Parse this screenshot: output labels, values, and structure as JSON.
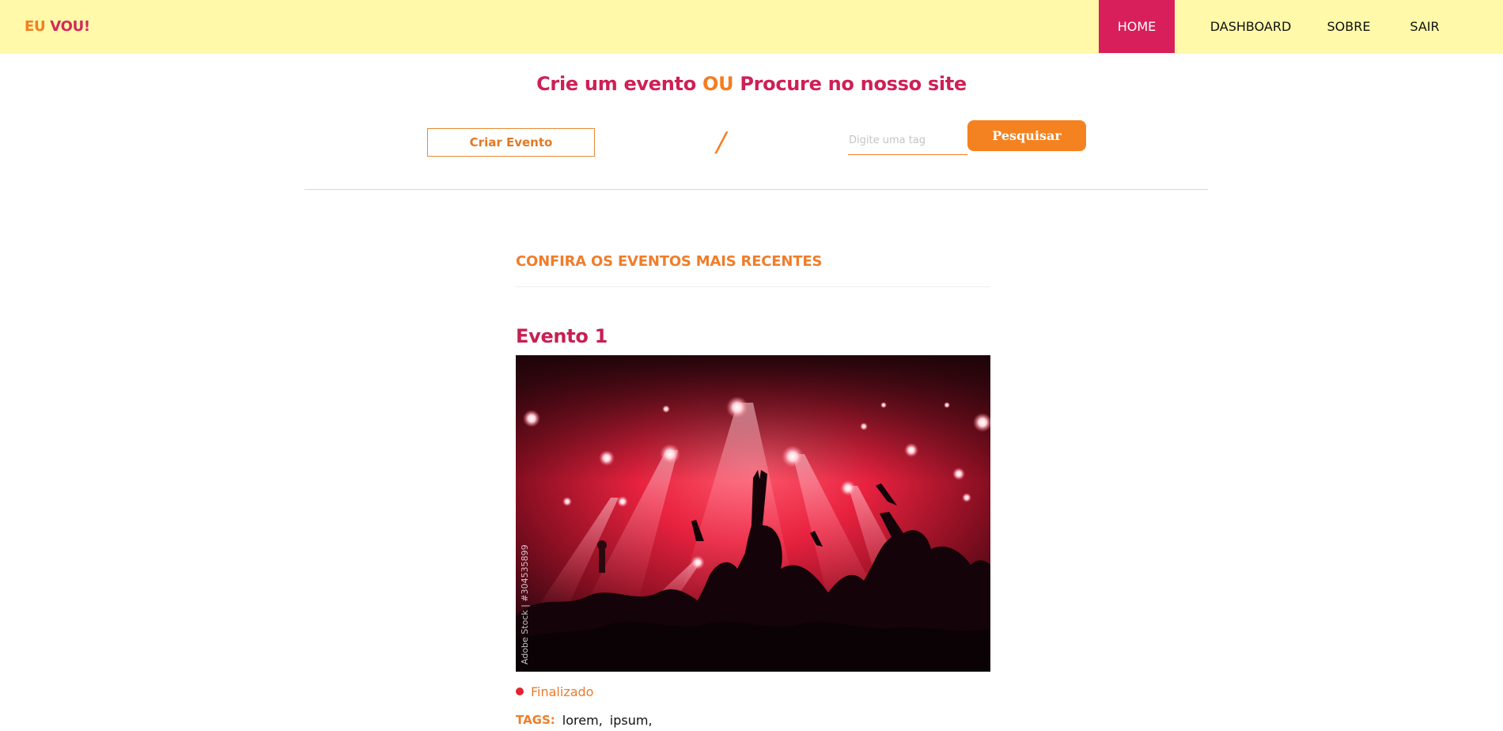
{
  "navbar": {
    "logo_part1": "EU",
    "logo_part2": "VOU!",
    "items": [
      {
        "label": "HOME",
        "active": true
      },
      {
        "label": "DASHBOARD"
      },
      {
        "label": "SOBRE"
      },
      {
        "label": "SAIR"
      }
    ],
    "background_color": "#fff9a9",
    "active_color": "#d81f5b"
  },
  "hero": {
    "headline_part1": "Crie um evento",
    "headline_or": "OU",
    "headline_part2": "Procure no nosso site",
    "create_button": "Criar Evento",
    "separator": "/",
    "search_placeholder": "Digite uma tag",
    "search_value": "",
    "search_button": "Pesquisar"
  },
  "events_section": {
    "title": "CONFIRA OS EVENTOS MAIS RECENTES",
    "events": [
      {
        "title": "Evento 1",
        "image_alt": "concert crowd under red stage lights",
        "watermark": "Adobe Stock | #304535899",
        "status": "Finalizado",
        "status_color": "#e2242f",
        "tags_label": "TAGS:",
        "tags": [
          "lorem,",
          "ipsum,"
        ]
      }
    ]
  },
  "colors": {
    "brand_orange": "#f47d22",
    "brand_pink": "#d22a5b"
  }
}
